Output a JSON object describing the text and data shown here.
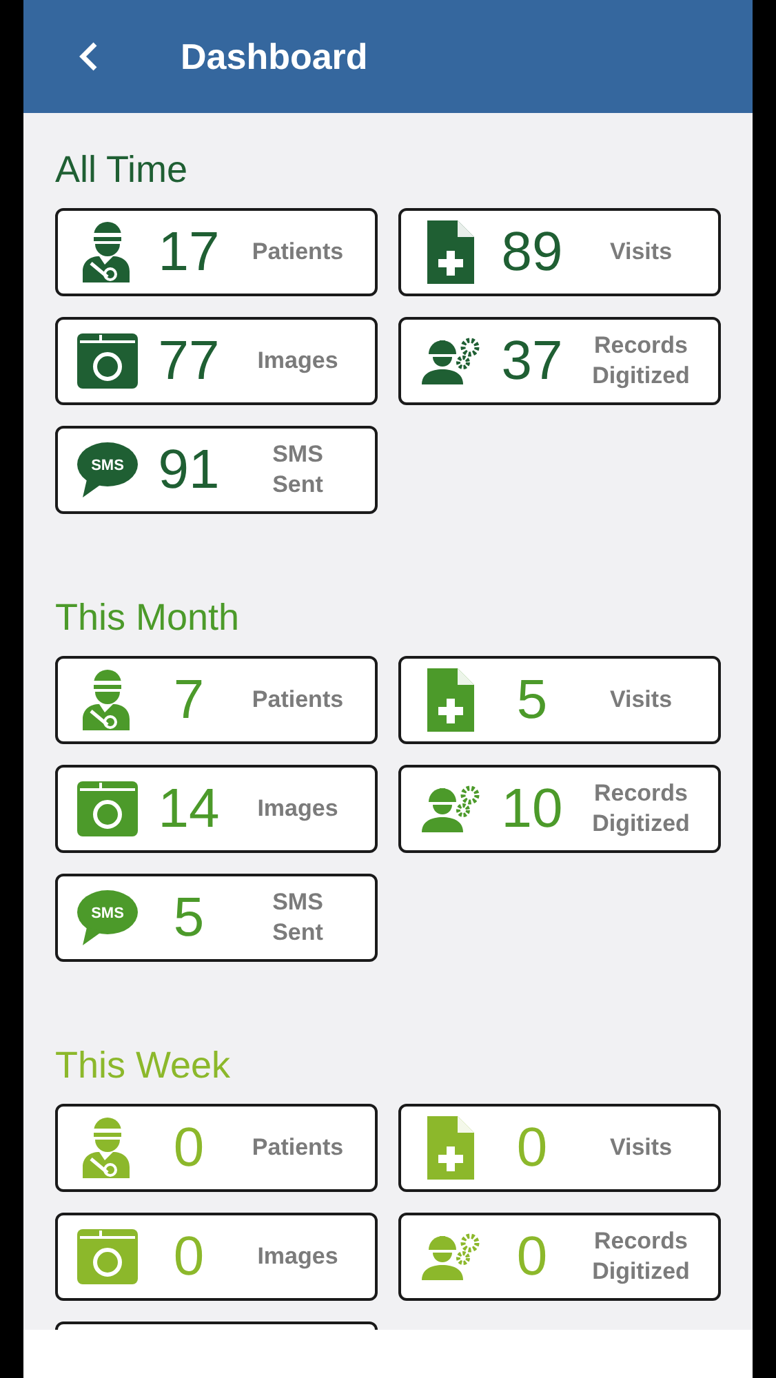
{
  "header": {
    "title": "Dashboard"
  },
  "sections": [
    {
      "title": "All Time",
      "color": "#1f5f33",
      "cards": [
        {
          "kind": "patients",
          "value": "17",
          "label_lines": [
            "Patients"
          ]
        },
        {
          "kind": "visits",
          "value": "89",
          "label_lines": [
            "Visits"
          ]
        },
        {
          "kind": "images",
          "value": "77",
          "label_lines": [
            "Images"
          ]
        },
        {
          "kind": "records",
          "value": "37",
          "label_lines": [
            "Records",
            "Digitized"
          ]
        },
        {
          "kind": "sms",
          "icon_text": "SMS",
          "value": "91",
          "label_lines": [
            "SMS",
            "Sent"
          ]
        }
      ]
    },
    {
      "title": "This Month",
      "color": "#4c9a2a",
      "cards": [
        {
          "kind": "patients",
          "value": "7",
          "label_lines": [
            "Patients"
          ]
        },
        {
          "kind": "visits",
          "value": "5",
          "label_lines": [
            "Visits"
          ]
        },
        {
          "kind": "images",
          "value": "14",
          "label_lines": [
            "Images"
          ]
        },
        {
          "kind": "records",
          "value": "10",
          "label_lines": [
            "Records",
            "Digitized"
          ]
        },
        {
          "kind": "sms",
          "icon_text": "SMS",
          "value": "5",
          "label_lines": [
            "SMS",
            "Sent"
          ]
        }
      ]
    },
    {
      "title": "This Week",
      "color": "#8cb82b",
      "cards": [
        {
          "kind": "patients",
          "value": "0",
          "label_lines": [
            "Patients"
          ]
        },
        {
          "kind": "visits",
          "value": "0",
          "label_lines": [
            "Visits"
          ]
        },
        {
          "kind": "images",
          "value": "0",
          "label_lines": [
            "Images"
          ]
        },
        {
          "kind": "records",
          "value": "0",
          "label_lines": [
            "Records",
            "Digitized"
          ]
        }
      ]
    }
  ]
}
